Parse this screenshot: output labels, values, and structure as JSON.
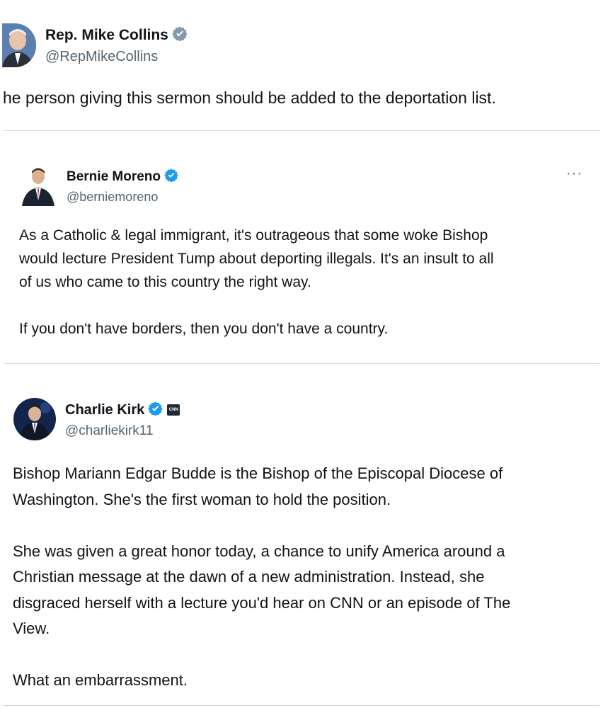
{
  "tweets": [
    {
      "name": "Rep. Mike Collins",
      "handle": "@RepMikeCollins",
      "badge": "gray",
      "text": [
        "he person giving this sermon should be added to the deportation list."
      ]
    },
    {
      "name": "Bernie Moreno",
      "handle": "@berniemoreno",
      "badge": "blue",
      "more_label": "···",
      "text": [
        "As a Catholic & legal immigrant, it's outrageous that some woke Bishop",
        "would lecture President Tump about deporting illegals. It's an insult to all",
        "of us who came to this country the right way.",
        "",
        "If you don't have borders, then you don't have a country."
      ]
    },
    {
      "name": "Charlie Kirk",
      "handle": "@charliekirk11",
      "badge": "blue",
      "affiliate_badge": "CNN",
      "text": [
        "Bishop Mariann Edgar Budde is the Bishop of the Episcopal Diocese of",
        "Washington. She's the first woman to hold the position.",
        "",
        "She was given a great honor today, a chance to unify America around a",
        "Christian message at the dawn of a new administration. Instead, she",
        "disgraced herself with a lecture you'd hear on CNN or an episode of The",
        "View.",
        "",
        "What an embarrassment."
      ]
    }
  ],
  "colors": {
    "verified_blue": "#1d9bf0",
    "verified_gray": "#829aab",
    "divider": "#cfd9de"
  }
}
